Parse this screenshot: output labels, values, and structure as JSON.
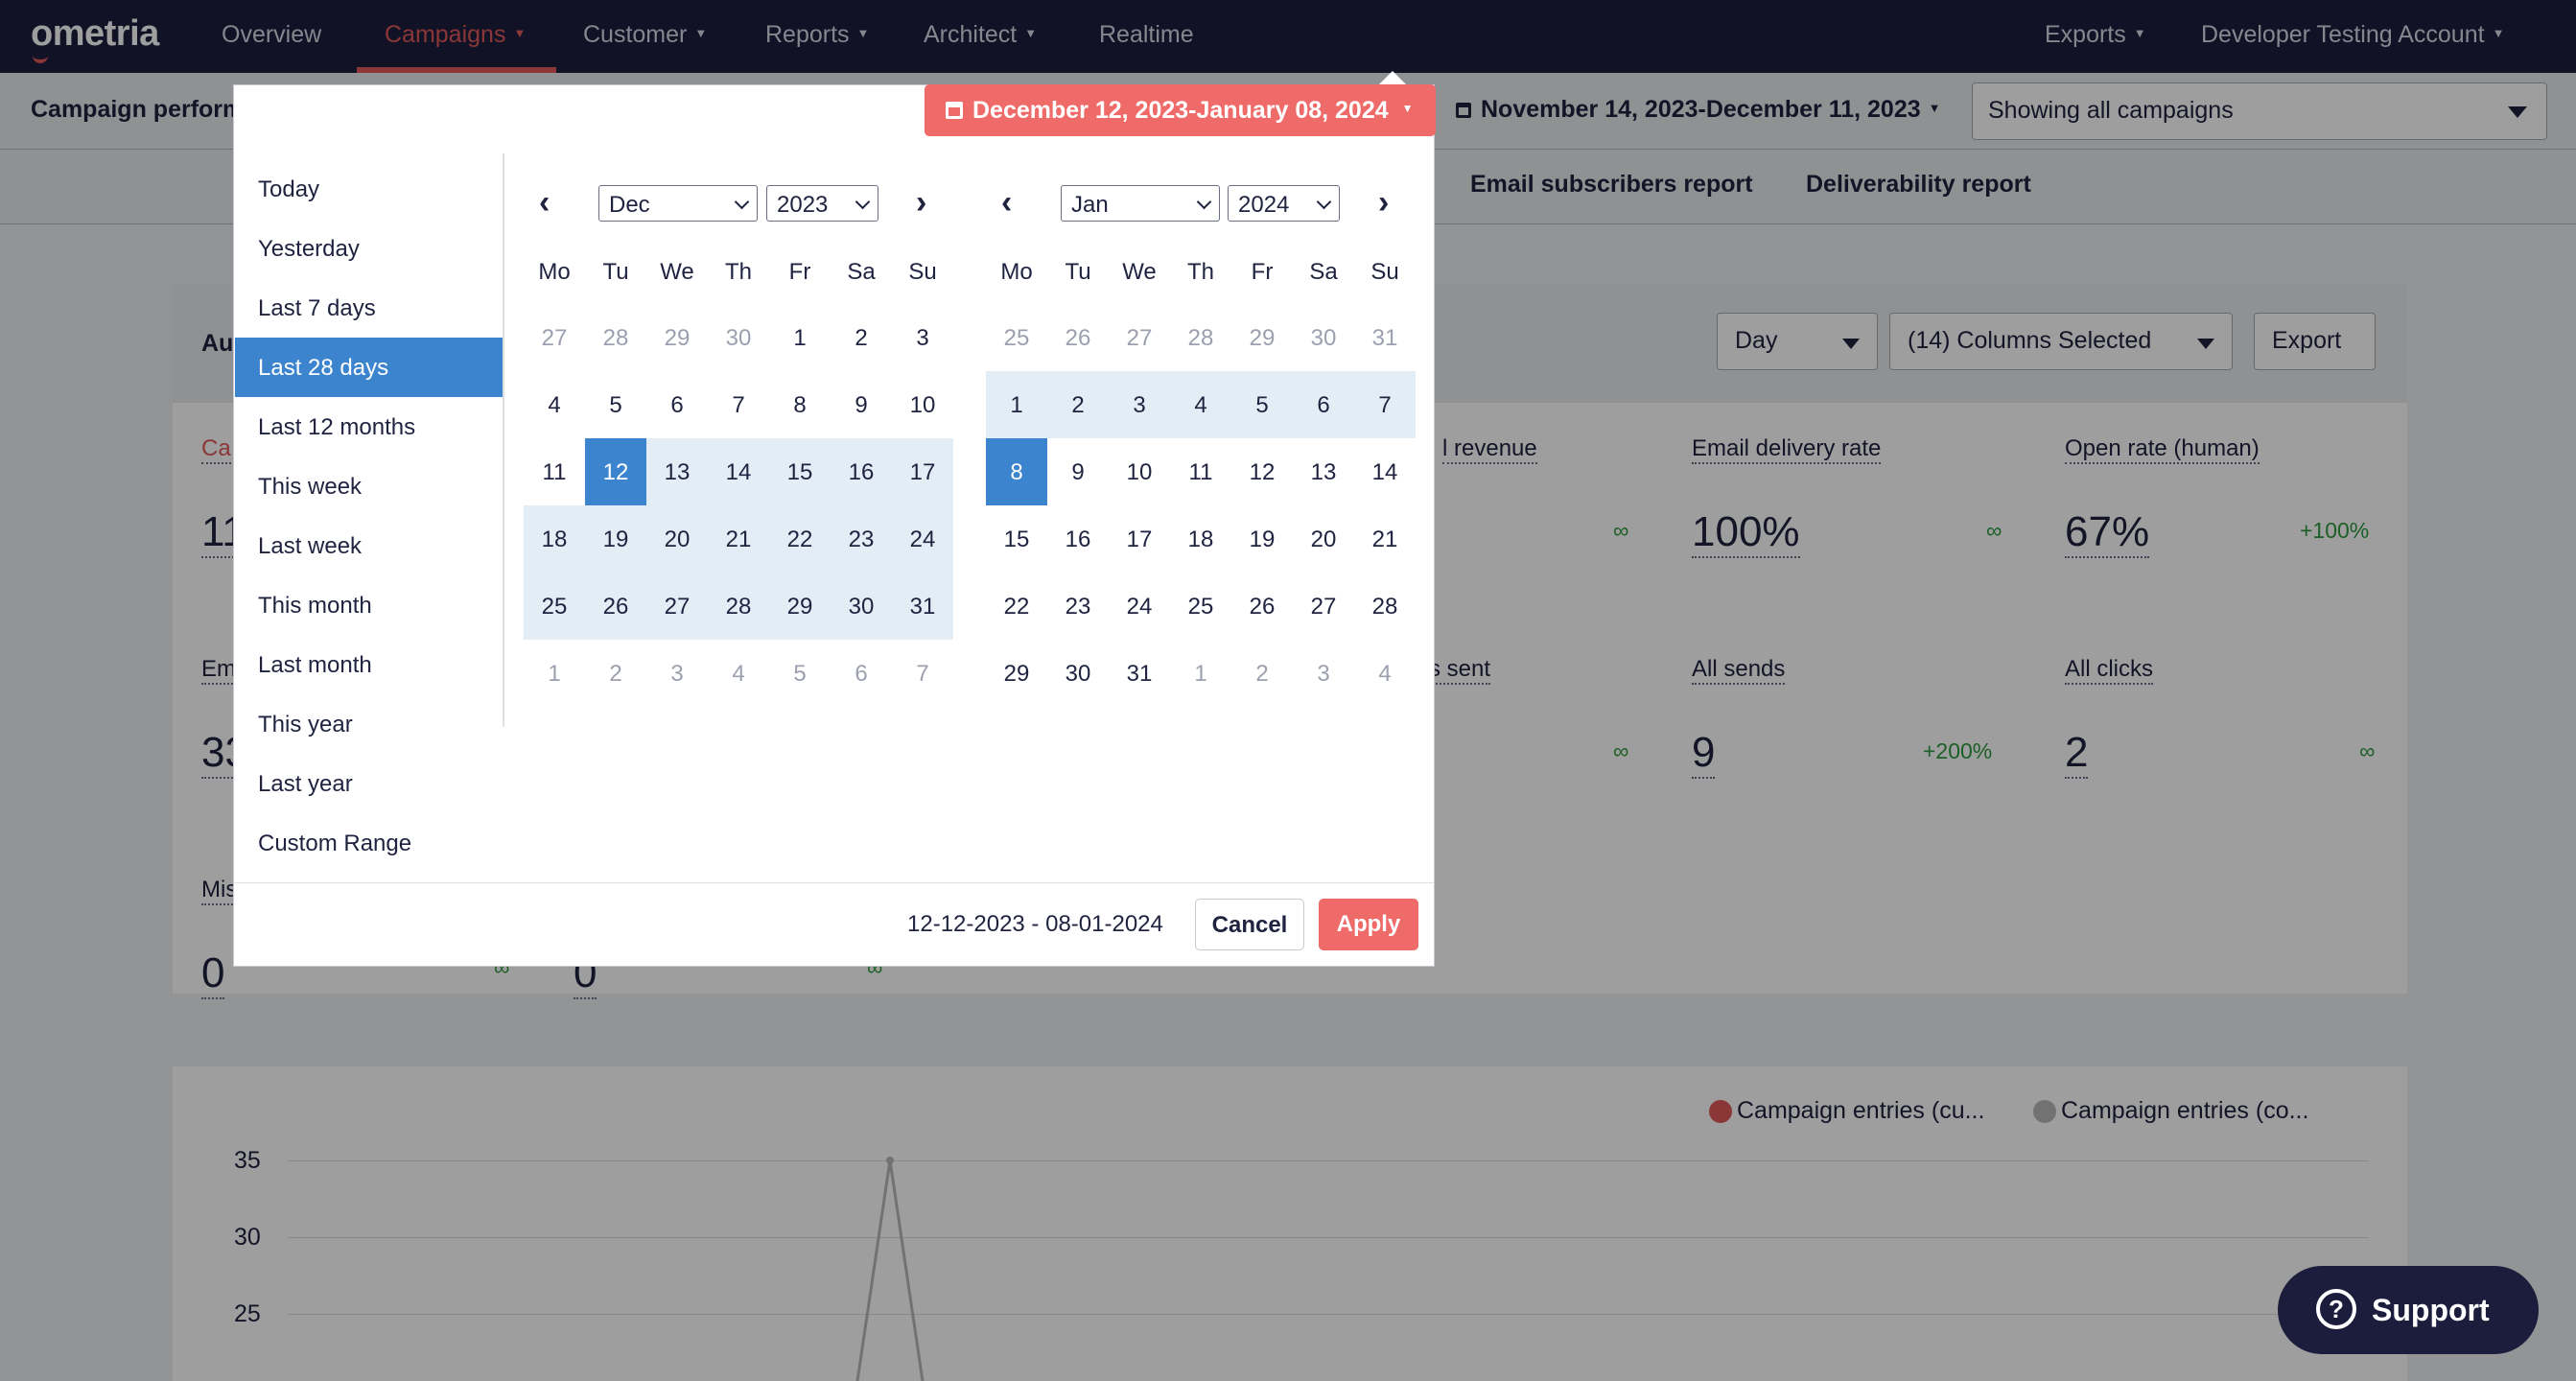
{
  "nav": {
    "logo": "ometria",
    "items": [
      "Overview",
      "Campaigns",
      "Customer",
      "Reports",
      "Architect",
      "Realtime"
    ],
    "exports": "Exports",
    "account": "Developer Testing Account"
  },
  "subbar": {
    "title": "Campaign performance",
    "compare_range": "November 14, 2023-December 11, 2023",
    "campaign_filter": "Showing all campaigns"
  },
  "tabs": [
    "Email subscribers report",
    "Deliverability report"
  ],
  "toolbar": {
    "section_title": "Au",
    "granularity": "Day",
    "columns": "(14) Columns Selected",
    "export": "Export"
  },
  "metrics_row1": [
    {
      "label": "Ca",
      "value": "11",
      "change": ""
    },
    {
      "label": "l revenue",
      "value": "",
      "change": "∞"
    },
    {
      "label": "Email delivery rate",
      "value": "100%",
      "change": "∞"
    },
    {
      "label": "Open rate (human)",
      "value": "67%",
      "change": "+100%"
    }
  ],
  "metrics_row2": [
    {
      "label": "Em (hu",
      "value": "33",
      "change": ""
    },
    {
      "label": "s sent",
      "value": "",
      "change": "∞"
    },
    {
      "label": "All sends",
      "value": "9",
      "change": "+200%"
    },
    {
      "label": "All clicks",
      "value": "2",
      "change": "∞"
    }
  ],
  "metrics_row3": [
    {
      "label": "Mis",
      "value": "0",
      "change": "∞"
    },
    {
      "label": "",
      "value": "0",
      "change": "∞"
    }
  ],
  "chart": {
    "legend": [
      "Campaign entries (cu...",
      "Campaign entries (co..."
    ],
    "legend_colors": [
      "#e0595b",
      "#b8b8b8"
    ],
    "yticks": [
      "35",
      "30",
      "25"
    ]
  },
  "support": "Support",
  "picker": {
    "trigger_label": "December 12, 2023-January 08, 2024",
    "ranges": [
      "Today",
      "Yesterday",
      "Last 7 days",
      "Last 28 days",
      "Last 12 months",
      "This week",
      "Last week",
      "This month",
      "Last month",
      "This year",
      "Last year",
      "Custom Range"
    ],
    "selected_range": "Last 28 days",
    "weekdays": [
      "Mo",
      "Tu",
      "We",
      "Th",
      "Fr",
      "Sa",
      "Su"
    ],
    "left": {
      "month": "Dec",
      "year": "2023",
      "weeks": [
        [
          [
            "27",
            "off"
          ],
          [
            "28",
            "off"
          ],
          [
            "29",
            "off"
          ],
          [
            "30",
            "off"
          ],
          [
            "1",
            ""
          ],
          [
            "2",
            ""
          ],
          [
            "3",
            ""
          ]
        ],
        [
          [
            "4",
            ""
          ],
          [
            "5",
            ""
          ],
          [
            "6",
            ""
          ],
          [
            "7",
            ""
          ],
          [
            "8",
            ""
          ],
          [
            "9",
            ""
          ],
          [
            "10",
            ""
          ]
        ],
        [
          [
            "11",
            ""
          ],
          [
            "12",
            "endpoint"
          ],
          [
            "13",
            "inrange"
          ],
          [
            "14",
            "inrange"
          ],
          [
            "15",
            "inrange"
          ],
          [
            "16",
            "inrange"
          ],
          [
            "17",
            "inrange"
          ]
        ],
        [
          [
            "18",
            "inrange"
          ],
          [
            "19",
            "inrange"
          ],
          [
            "20",
            "inrange"
          ],
          [
            "21",
            "inrange"
          ],
          [
            "22",
            "inrange"
          ],
          [
            "23",
            "inrange"
          ],
          [
            "24",
            "inrange"
          ]
        ],
        [
          [
            "25",
            "inrange"
          ],
          [
            "26",
            "inrange"
          ],
          [
            "27",
            "inrange"
          ],
          [
            "28",
            "inrange"
          ],
          [
            "29",
            "inrange"
          ],
          [
            "30",
            "inrange"
          ],
          [
            "31",
            "inrange"
          ]
        ],
        [
          [
            "1",
            "off"
          ],
          [
            "2",
            "off"
          ],
          [
            "3",
            "off"
          ],
          [
            "4",
            "off"
          ],
          [
            "5",
            "off"
          ],
          [
            "6",
            "off"
          ],
          [
            "7",
            "off"
          ]
        ]
      ]
    },
    "right": {
      "month": "Jan",
      "year": "2024",
      "weeks": [
        [
          [
            "25",
            "off"
          ],
          [
            "26",
            "off"
          ],
          [
            "27",
            "off"
          ],
          [
            "28",
            "off"
          ],
          [
            "29",
            "off"
          ],
          [
            "30",
            "off"
          ],
          [
            "31",
            "off"
          ]
        ],
        [
          [
            "1",
            "inrange"
          ],
          [
            "2",
            "inrange"
          ],
          [
            "3",
            "inrange"
          ],
          [
            "4",
            "inrange"
          ],
          [
            "5",
            "inrange"
          ],
          [
            "6",
            "inrange"
          ],
          [
            "7",
            "inrange"
          ]
        ],
        [
          [
            "8",
            "endpoint"
          ],
          [
            "9",
            ""
          ],
          [
            "10",
            ""
          ],
          [
            "11",
            ""
          ],
          [
            "12",
            ""
          ],
          [
            "13",
            ""
          ],
          [
            "14",
            ""
          ]
        ],
        [
          [
            "15",
            ""
          ],
          [
            "16",
            ""
          ],
          [
            "17",
            ""
          ],
          [
            "18",
            ""
          ],
          [
            "19",
            ""
          ],
          [
            "20",
            ""
          ],
          [
            "21",
            ""
          ]
        ],
        [
          [
            "22",
            ""
          ],
          [
            "23",
            ""
          ],
          [
            "24",
            ""
          ],
          [
            "25",
            ""
          ],
          [
            "26",
            ""
          ],
          [
            "27",
            ""
          ],
          [
            "28",
            ""
          ]
        ],
        [
          [
            "29",
            ""
          ],
          [
            "30",
            ""
          ],
          [
            "31",
            ""
          ],
          [
            "1",
            "off"
          ],
          [
            "2",
            "off"
          ],
          [
            "3",
            "off"
          ],
          [
            "4",
            "off"
          ]
        ]
      ]
    },
    "summary": "12-12-2023 - 08-01-2024",
    "cancel": "Cancel",
    "apply": "Apply"
  }
}
